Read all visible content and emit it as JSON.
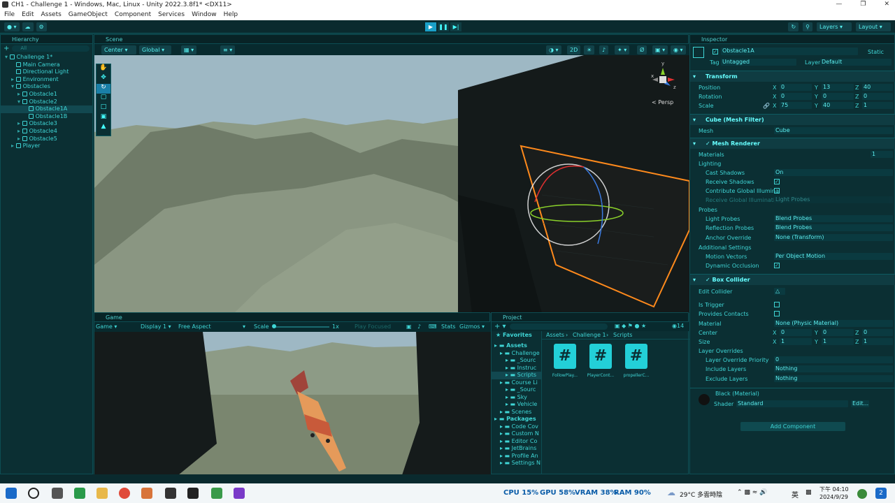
{
  "window": {
    "title": "CH1 - Challenge 1 - Windows, Mac, Linux - Unity 2022.3.8f1* <DX11>"
  },
  "menu": [
    "File",
    "Edit",
    "Assets",
    "GameObject",
    "Component",
    "Services",
    "Window",
    "Help"
  ],
  "toolbar": {
    "layers": "Layers",
    "layout": "Layout"
  },
  "hierarchy": {
    "tab": "Hierarchy",
    "search_placeholder": "All",
    "items": [
      {
        "label": "Challenge 1*",
        "depth": 0
      },
      {
        "label": "Main Camera",
        "depth": 1
      },
      {
        "label": "Directional Light",
        "depth": 1
      },
      {
        "label": "Environment",
        "depth": 1
      },
      {
        "label": "Obstacles",
        "depth": 1
      },
      {
        "label": "Obstacle1",
        "depth": 2
      },
      {
        "label": "Obstacle2",
        "depth": 2
      },
      {
        "label": "Obstacle1A",
        "depth": 3,
        "selected": true
      },
      {
        "label": "Obstacle1B",
        "depth": 3
      },
      {
        "label": "Obstacle3",
        "depth": 2
      },
      {
        "label": "Obstacle4",
        "depth": 2
      },
      {
        "label": "Obstacle5",
        "depth": 2
      },
      {
        "label": "Player",
        "depth": 1
      }
    ]
  },
  "scene": {
    "tab": "Scene",
    "pivot": "Center",
    "space": "Global",
    "mode_2d": "2D",
    "persp": "< Persp",
    "gizmo_axes": {
      "y": "y",
      "x": "x",
      "z": "z"
    }
  },
  "game": {
    "tab": "Game",
    "mode": "Game",
    "display": "Display 1",
    "aspect": "Free Aspect",
    "scale_label": "Scale",
    "scale_value": "1x",
    "play_focused": "Play Focused",
    "stats": "Stats",
    "gizmos": "Gizmos"
  },
  "project": {
    "tab": "Project",
    "favorites": "Favorites",
    "breadcrumb": [
      "Assets",
      "Challenge 1",
      "Scripts"
    ],
    "tree": [
      {
        "label": "Assets",
        "depth": 0
      },
      {
        "label": "Challenge",
        "depth": 1
      },
      {
        "label": "_Sourc",
        "depth": 2
      },
      {
        "label": "Instruc",
        "depth": 2
      },
      {
        "label": "Scripts",
        "depth": 2,
        "selected": true
      },
      {
        "label": "Course Li",
        "depth": 1
      },
      {
        "label": "_Sourc",
        "depth": 2
      },
      {
        "label": "Sky",
        "depth": 2
      },
      {
        "label": "Vehicle",
        "depth": 2
      },
      {
        "label": "Scenes",
        "depth": 1
      },
      {
        "label": "Packages",
        "depth": 0
      },
      {
        "label": "Code Cov",
        "depth": 1
      },
      {
        "label": "Custom N",
        "depth": 1
      },
      {
        "label": "Editor Co",
        "depth": 1
      },
      {
        "label": "JetBrains",
        "depth": 1
      },
      {
        "label": "Profile An",
        "depth": 1
      },
      {
        "label": "Settings N",
        "depth": 1
      }
    ],
    "files": [
      "FollowPlay...",
      "PlayerCont...",
      "propellerC..."
    ],
    "count": "14"
  },
  "inspector": {
    "tab": "Inspector",
    "object_name": "Obstacle1A",
    "static": "Static",
    "tag_label": "Tag",
    "tag": "Untagged",
    "layer_label": "Layer",
    "layer": "Default",
    "transform": {
      "title": "Transform",
      "position": {
        "label": "Position",
        "x": "0",
        "y": "13",
        "z": "40"
      },
      "rotation": {
        "label": "Rotation",
        "x": "0",
        "y": "0",
        "z": "0"
      },
      "scale": {
        "label": "Scale",
        "x": "75",
        "y": "40",
        "z": "1"
      }
    },
    "mesh_filter": {
      "title": "Cube (Mesh Filter)",
      "mesh_label": "Mesh",
      "mesh": "Cube"
    },
    "mesh_renderer": {
      "title": "Mesh Renderer",
      "materials": "Materials",
      "materials_count": "1",
      "lighting": "Lighting",
      "cast_shadows": "Cast Shadows",
      "cast_shadows_value": "On",
      "receive_shadows": "Receive Shadows",
      "contribute_gi": "Contribute Global Illumina",
      "receive_gi": "Receive Global Illuminati",
      "receive_gi_value": "Light Probes",
      "probes": "Probes",
      "light_probes": "Light Probes",
      "light_probes_value": "Blend Probes",
      "reflection_probes": "Reflection Probes",
      "reflection_probes_value": "Blend Probes",
      "anchor_override": "Anchor Override",
      "anchor_override_value": "None (Transform)",
      "additional": "Additional Settings",
      "motion_vectors": "Motion Vectors",
      "motion_vectors_value": "Per Object Motion",
      "dynamic_occlusion": "Dynamic Occlusion"
    },
    "box_collider": {
      "title": "Box Collider",
      "edit_collider": "Edit Collider",
      "is_trigger": "Is Trigger",
      "provides_contacts": "Provides Contacts",
      "material": "Material",
      "material_value": "None (Physic Material)",
      "center": {
        "label": "Center",
        "x": "0",
        "y": "0",
        "z": "0"
      },
      "size": {
        "label": "Size",
        "x": "1",
        "y": "1",
        "z": "1"
      },
      "layer_overrides": "Layer Overrides",
      "layer_override_priority": "Layer Override Priority",
      "priority_value": "0",
      "include_layers": "Include Layers",
      "include_value": "Nothing",
      "exclude_layers": "Exclude Layers",
      "exclude_value": "Nothing"
    },
    "material": {
      "title": "Black (Material)",
      "shader_label": "Shader",
      "shader": "Standard",
      "edit": "Edit..."
    },
    "add_component": "Add Component"
  },
  "taskbar": {
    "cpu": "CPU 15%",
    "gpu": "GPU 58%",
    "vram": "VRAM 38%",
    "ram": "RAM 90%",
    "weather": "29°C 多雲時陰",
    "ime": "英",
    "time": "下午 04:10",
    "date": "2024/9/29",
    "notif": "2"
  },
  "colors": {
    "accent": "#3fd6d6",
    "panel": "#0b2f33",
    "selection": "#ff8a1c",
    "play": "#1aa0c8"
  }
}
